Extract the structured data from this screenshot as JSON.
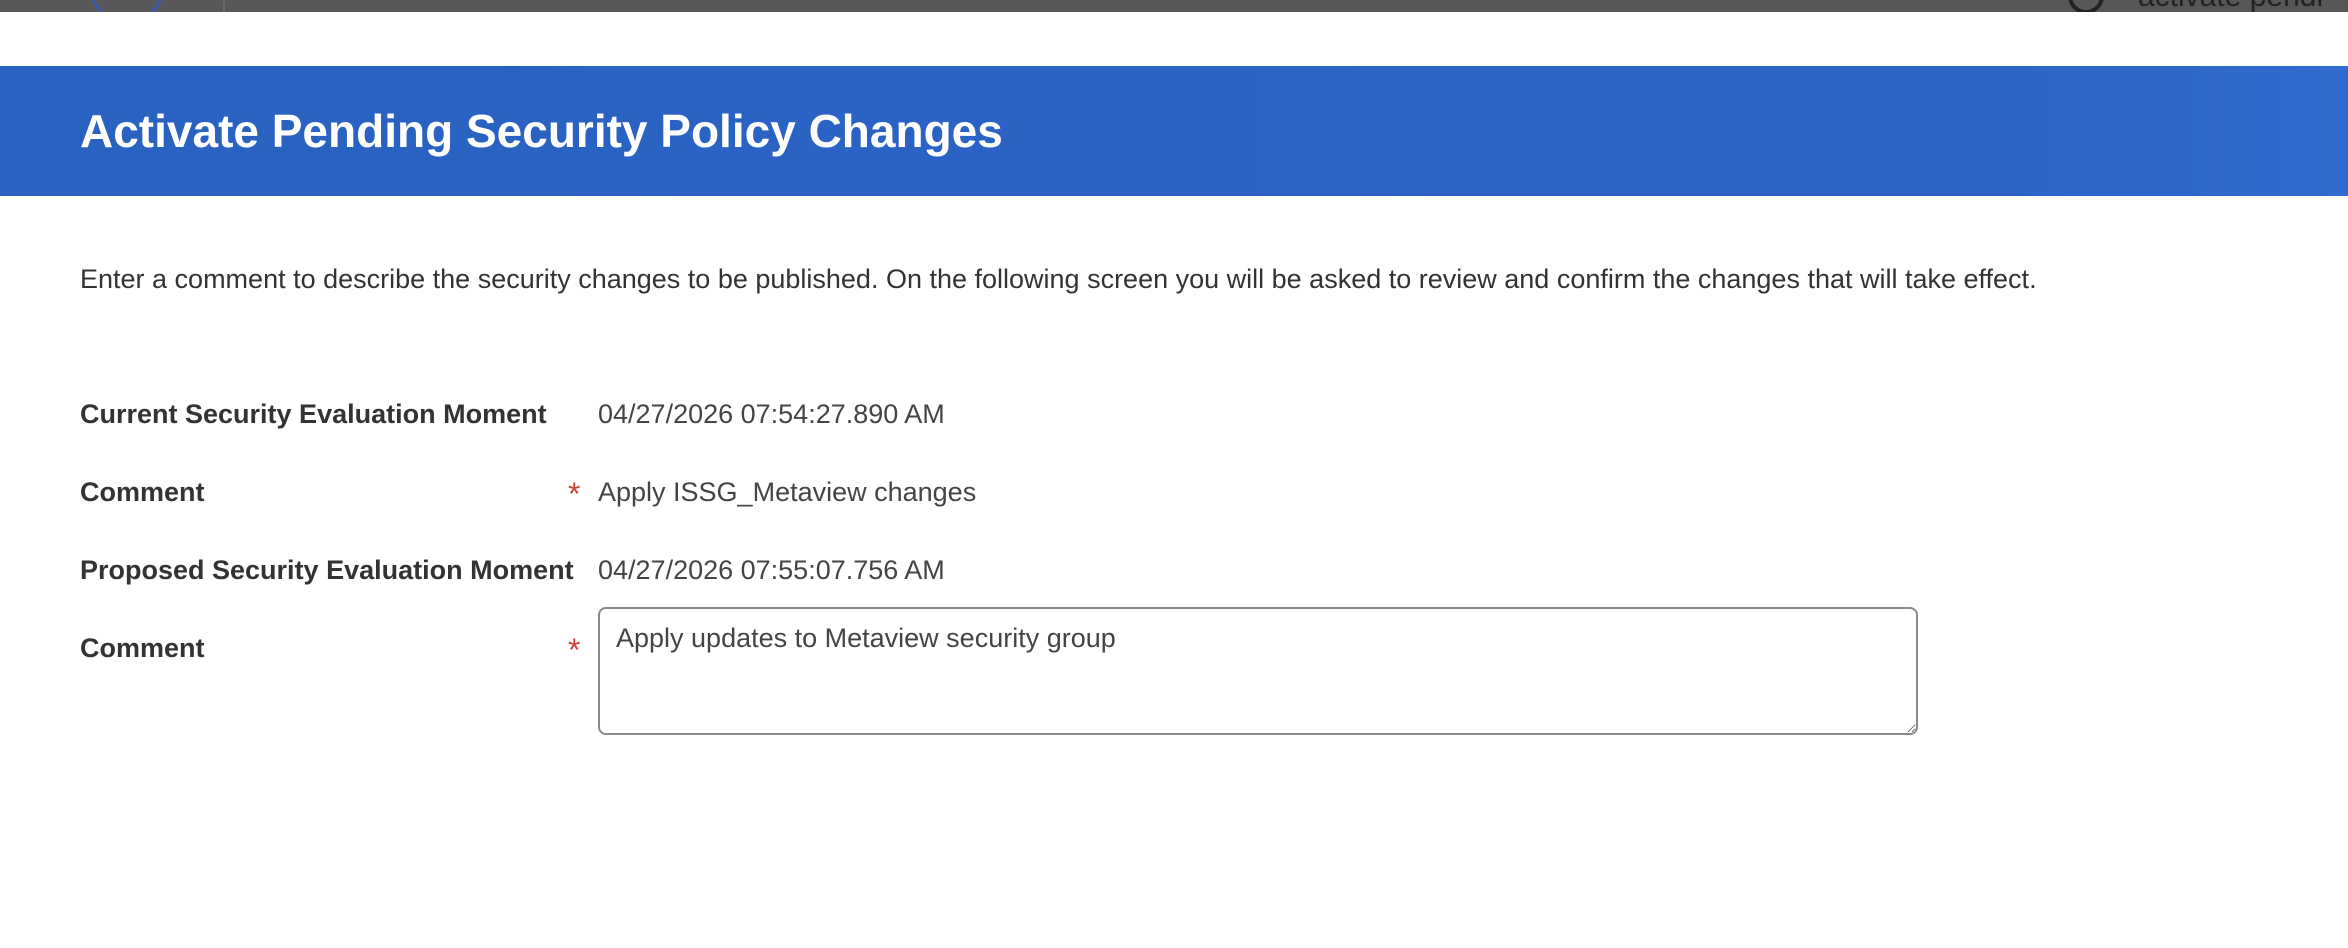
{
  "topbar": {
    "search_text": "activate pendi"
  },
  "dialog": {
    "title": "Activate Pending Security Policy Changes",
    "instructions": "Enter a comment to describe the security changes to be published. On the following screen you will be asked to review and confirm the changes that will take effect."
  },
  "fields": {
    "current_moment": {
      "label": "Current Security Evaluation Moment",
      "value": "04/27/2026 07:54:27.890 AM"
    },
    "comment_previous": {
      "label": "Comment",
      "required_mark": "*",
      "value": "Apply ISSG_Metaview changes"
    },
    "proposed_moment": {
      "label": "Proposed Security Evaluation Moment",
      "value": "04/27/2026 07:55:07.756 AM"
    },
    "comment_new": {
      "label": "Comment",
      "required_mark": "*",
      "value": "Apply updates to Metaview security group"
    }
  },
  "colors": {
    "header_bg": "#2b64c4",
    "required": "#d14335"
  }
}
